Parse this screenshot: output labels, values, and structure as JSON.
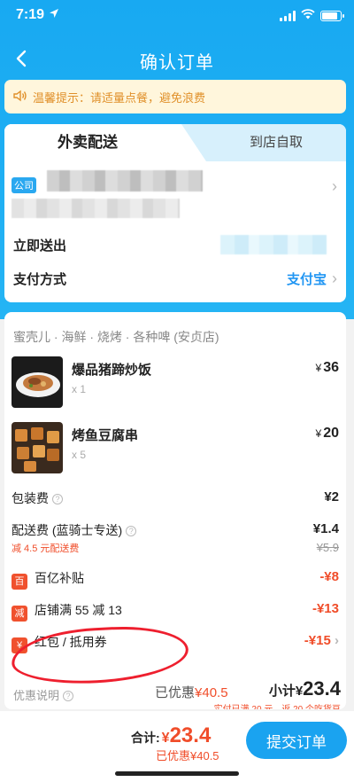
{
  "status": {
    "time": "7:19"
  },
  "nav": {
    "title": "确认订单"
  },
  "notice": {
    "text": "温馨提示：请适量点餐，避免浪费"
  },
  "tabs": {
    "delivery": "外卖配送",
    "pickup": "到店自取"
  },
  "address": {
    "tag": "公司"
  },
  "delivery_time": {
    "label": "立即送出"
  },
  "payment": {
    "label": "支付方式",
    "value": "支付宝"
  },
  "shop": {
    "name": "蜜壳儿 · 海鲜 · 烧烤 · 各种啤 (安贞店)"
  },
  "items": [
    {
      "name": "爆品猪蹄炒饭",
      "qty": "x 1",
      "currency": "¥",
      "price": "36"
    },
    {
      "name": "烤鱼豆腐串",
      "qty": "x 5",
      "currency": "¥",
      "price": "20"
    }
  ],
  "fees": {
    "packing": {
      "label": "包装费",
      "value": "¥2"
    },
    "delivery": {
      "label": "配送费 (蓝骑士专送)",
      "value": "¥1.4",
      "promo": "减 4.5 元配送费",
      "original": "¥5.9"
    }
  },
  "discounts": [
    {
      "badge": "百",
      "label": "百亿补贴",
      "value": "-¥8",
      "color": "#f0512e"
    },
    {
      "badge": "减",
      "label": "店铺满 55 减 13",
      "value": "-¥13",
      "color": "#f0512e"
    },
    {
      "badge": "¥",
      "label": "红包 / 抵用券",
      "value": "-¥15",
      "color": "#f0512e"
    }
  ],
  "summary": {
    "label": "优惠说明",
    "discount_prefix": "已优惠",
    "discount_value": "¥40.5",
    "subtotal_prefix": "小计",
    "subtotal_currency": "¥",
    "subtotal_value": "23.4",
    "note": "实付已满 20 元，返 20 个吃货豆"
  },
  "footer": {
    "total_label": "合计:",
    "total_currency": "¥",
    "total_value": "23.4",
    "discount_text": "已优惠¥40.5",
    "submit_label": "提交订单"
  },
  "colors": {
    "brand": "#1aa3f0",
    "accent_red": "#f04d2a",
    "notice": "#e0902a"
  }
}
